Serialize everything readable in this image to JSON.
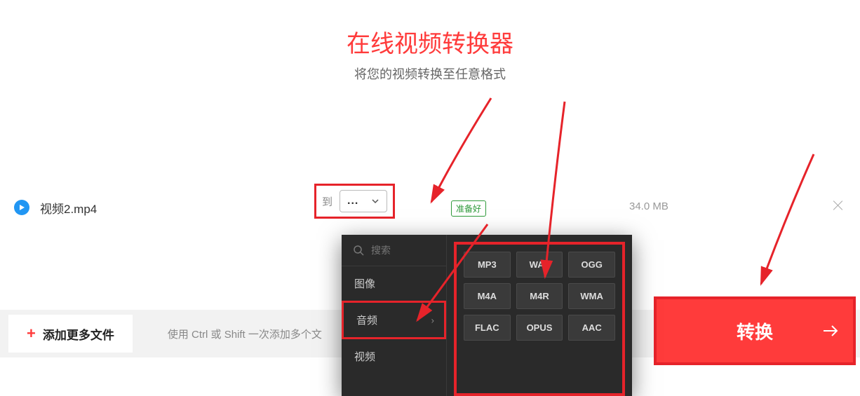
{
  "header": {
    "title": "在线视频转换器",
    "subtitle": "将您的视频转换至任意格式"
  },
  "file": {
    "name": "视频2.mp4",
    "to_label": "到",
    "selected_format": "...",
    "status": "准备好",
    "size": "34.0 MB"
  },
  "bottom": {
    "add_more": "添加更多文件",
    "hint": "使用 Ctrl 或 Shift 一次添加多个文",
    "convert": "转换"
  },
  "dropdown": {
    "search_placeholder": "搜索",
    "categories": {
      "image": "图像",
      "audio": "音频",
      "video": "视频"
    },
    "formats": [
      "MP3",
      "WAV",
      "OGG",
      "M4A",
      "M4R",
      "WMA",
      "FLAC",
      "OPUS",
      "AAC"
    ]
  }
}
